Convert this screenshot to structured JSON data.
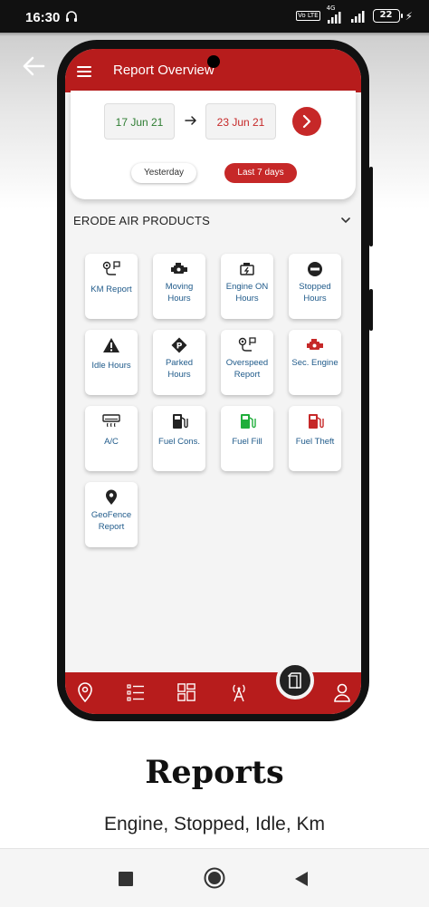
{
  "status_bar": {
    "time": "16:30",
    "battery": "22",
    "network_label": "4G",
    "volte": "Vo LTE"
  },
  "app": {
    "title": "Report Overview",
    "date_from": "17 Jun 21",
    "date_to": "23 Jun 21",
    "quick_ranges": [
      "Yesterday",
      "Last 7 days"
    ],
    "selected_range": "Last 7 days",
    "company": "ERODE AIR PRODUCTS",
    "tiles": [
      {
        "label": "KM Report",
        "icon": "route-icon"
      },
      {
        "label": "Moving Hours",
        "icon": "engine-icon"
      },
      {
        "label": "Engine ON Hours",
        "icon": "engine-on-icon"
      },
      {
        "label": "Stopped Hours",
        "icon": "stop-icon"
      },
      {
        "label": "Idle Hours",
        "icon": "warning-icon"
      },
      {
        "label": "Parked Hours",
        "icon": "parking-icon"
      },
      {
        "label": "Overspeed Report",
        "icon": "route-icon"
      },
      {
        "label": "Sec. Engine",
        "icon": "secondary-engine-icon"
      },
      {
        "label": "A/C",
        "icon": "air-conditioner-icon"
      },
      {
        "label": "Fuel Cons.",
        "icon": "fuel-pump-icon"
      },
      {
        "label": "Fuel Fill",
        "icon": "fuel-fill-icon"
      },
      {
        "label": "Fuel Theft",
        "icon": "fuel-theft-icon"
      },
      {
        "label": "GeoFence Report",
        "icon": "location-pin-icon"
      }
    ]
  },
  "caption": {
    "title": "Reports",
    "subtitle": "Engine, Stopped, Idle, Km"
  },
  "colors": {
    "brand_red": "#b71c1c",
    "accent_red": "#c62828",
    "from_green": "#2e7d32",
    "tile_text_blue": "#1f5a8a"
  }
}
